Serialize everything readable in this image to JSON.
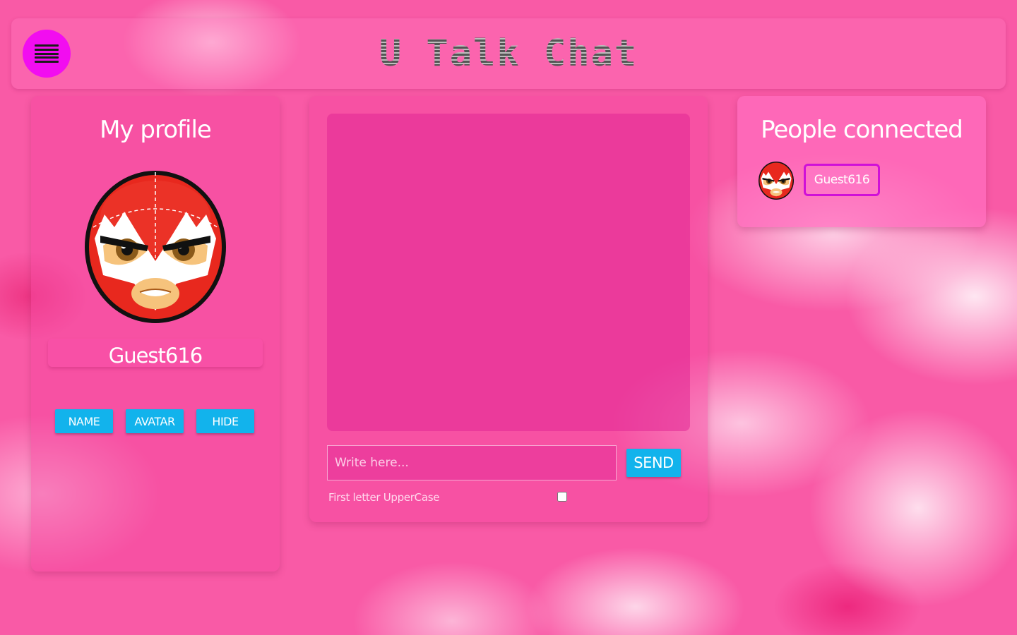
{
  "header": {
    "title": "U Talk Chat",
    "menu_icon": "hamburger-menu-icon"
  },
  "profile": {
    "title": "My profile",
    "avatar_icon": "luchador-mask-avatar",
    "username": "Guest616",
    "buttons": {
      "name": "NAME",
      "avatar": "AVATAR",
      "hide": "HIDE"
    }
  },
  "chat": {
    "input_placeholder": "Write here...",
    "input_value": "",
    "send_label": "SEND",
    "uppercase_label": "First letter UpperCase",
    "uppercase_checked": false
  },
  "people": {
    "title": "People connected",
    "users": [
      {
        "name": "Guest616",
        "avatar_icon": "luchador-mask-avatar"
      }
    ]
  },
  "colors": {
    "background": "#f95aa6",
    "menu_button": "#f20df0",
    "button": "#12b3ec",
    "user_border": "#d010d8",
    "mask_red": "#e8281e"
  }
}
